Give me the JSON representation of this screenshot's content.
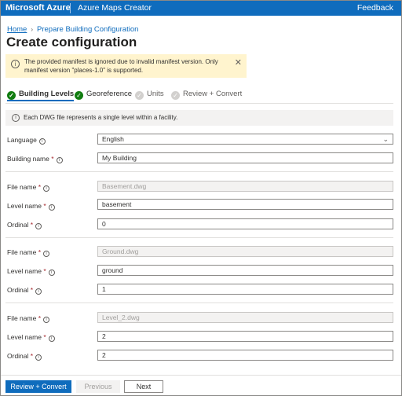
{
  "topbar": {
    "brand": "Microsoft Azure",
    "product": "Azure Maps Creator",
    "feedback": "Feedback"
  },
  "breadcrumb": {
    "home": "Home",
    "current": "Prepare Building Configuration"
  },
  "page": {
    "title": "Create configuration"
  },
  "warning": {
    "text": "The provided manifest is ignored due to invalid manifest version. Only manifest version \"places-1.0\" is supported.",
    "icon": "info-icon",
    "close": "✕"
  },
  "steps": [
    {
      "label": "Building Levels",
      "state": "done"
    },
    {
      "label": "Georeference",
      "state": "done"
    },
    {
      "label": "Units",
      "state": "todo"
    },
    {
      "label": "Review + Convert",
      "state": "todo"
    }
  ],
  "info": {
    "text": "Each DWG file represents a single level within a facility."
  },
  "form": {
    "language": {
      "label": "Language",
      "value": "English"
    },
    "building_name": {
      "label": "Building name",
      "value": "My Building"
    },
    "levels": [
      {
        "file_label": "File name",
        "file": "Basement.dwg",
        "level_label": "Level name",
        "level": "basement",
        "ordinal_label": "Ordinal",
        "ordinal": "0"
      },
      {
        "file_label": "File name",
        "file": "Ground.dwg",
        "level_label": "Level name",
        "level": "ground",
        "ordinal_label": "Ordinal",
        "ordinal": "1"
      },
      {
        "file_label": "File name",
        "file": "Level_2.dwg",
        "level_label": "Level name",
        "level": "2",
        "ordinal_label": "Ordinal",
        "ordinal": "2"
      }
    ]
  },
  "footer": {
    "primary": "Review + Convert",
    "previous": "Previous",
    "next": "Next"
  },
  "colors": {
    "accent": "#0f6cbd",
    "success": "#107c10",
    "warning_bg": "#fff4ce"
  }
}
